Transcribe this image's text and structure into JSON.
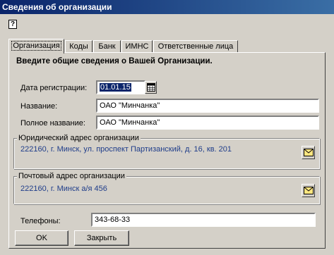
{
  "window": {
    "title": "Сведения об организации"
  },
  "help_icon": "question-mark-icon",
  "tabs": [
    {
      "label": "Организация",
      "active": true
    },
    {
      "label": "Коды",
      "active": false
    },
    {
      "label": "Банк",
      "active": false
    },
    {
      "label": "ИМНС",
      "active": false
    },
    {
      "label": "Ответственные лица",
      "active": false
    }
  ],
  "form": {
    "heading": "Введите общие сведения о Вашей Организации.",
    "reg_date_label": "Дата регистрации:",
    "reg_date_value": "01.01.15",
    "name_label": "Название:",
    "name_value": "ОАО \"Минчанка\"",
    "full_name_label": "Полное название:",
    "full_name_value": "ОАО \"Минчанка\"",
    "legal_address_caption": "Юридический адрес организации",
    "legal_address_value": "222160, г. Минск, ул. проспект Партизанский, д. 16, кв. 201",
    "postal_address_caption": "Почтовый адрес организации",
    "postal_address_value": "222160, г. Минск а/я 456",
    "phones_label": "Телефоны:",
    "phones_value": "343-68-33"
  },
  "buttons": {
    "ok": "OK",
    "close": "Закрыть"
  },
  "colors": {
    "titlebar_start": "#0a246a",
    "titlebar_end": "#3a6ea5",
    "address_text": "#1f3d8a",
    "window_bg": "#d4d0c8"
  }
}
